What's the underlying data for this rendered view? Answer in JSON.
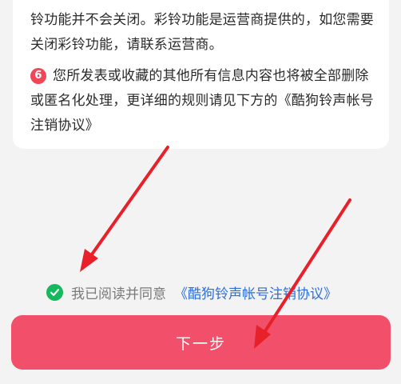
{
  "card": {
    "line1": "铃功能并不会关闭。彩铃功能是运营商提供的，如您需要",
    "line2": "关闭彩铃功能，请联系运营商。",
    "item6": {
      "number": "6",
      "line1": "您所发表或收藏的其他所有信息内容也将被全部删除",
      "line2": "或匿名化处理，更详细的规则请见下方的《酷狗铃声帐号",
      "line3": "注销协议》"
    }
  },
  "agreement": {
    "text": "我已阅读并同意",
    "link": "《酷狗铃声帐号注销协议》",
    "checked": true
  },
  "next_button": {
    "label": "下一步"
  },
  "colors": {
    "accent": "#f2506a",
    "check": "#14b85d",
    "link": "#2e6fd9",
    "annotation_arrow": "#e8202a"
  }
}
